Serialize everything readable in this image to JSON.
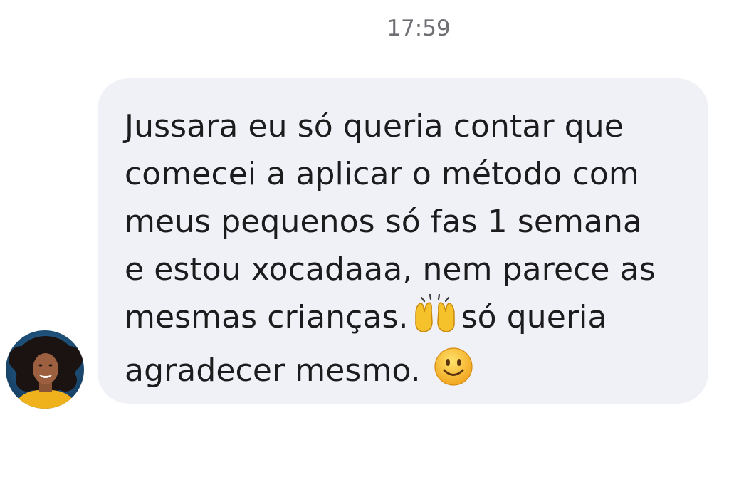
{
  "timestamp": "17:59",
  "message": {
    "lines": [
      "Jussara eu só queria contar que",
      "comecei a aplicar o método com",
      "meus pequenos só fas 1 semana",
      "e estou xocadaaa, nem parece as",
      "mesmas crianças.",
      "só queria",
      "agradecer mesmo."
    ],
    "emoji_1": "raising-hands-icon",
    "emoji_2": "smiling-face-icon"
  },
  "colors": {
    "bubble": "#f0f1f6",
    "text": "#1c1c1e",
    "timestamp": "#6e6e73",
    "avatar_ring": "#1e4f7a",
    "avatar_shirt": "#f0b21c"
  }
}
